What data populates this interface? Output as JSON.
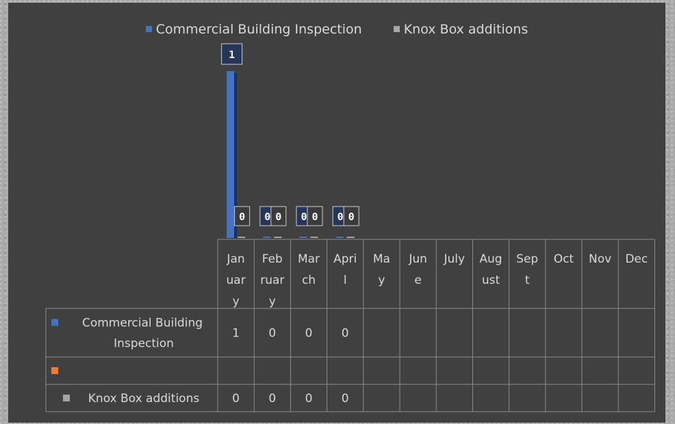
{
  "chart_data": {
    "type": "bar",
    "categories": [
      "Jan\nuar\ny",
      "Feb\nruar\ny",
      "Mar\nch",
      "Apri\nl",
      "Ma\ny",
      "Jun\ne",
      "July",
      "Aug\nust",
      "Sep\nt",
      "Oct",
      "Nov",
      "Dec"
    ],
    "series": [
      {
        "name": "Commercial Building Inspection",
        "color": "#4472c4",
        "values": [
          1,
          0,
          0,
          0,
          null,
          null,
          null,
          null,
          null,
          null,
          null,
          null
        ]
      },
      {
        "name": "",
        "color": "#ed7d31",
        "values": [
          null,
          null,
          null,
          null,
          null,
          null,
          null,
          null,
          null,
          null,
          null,
          null
        ]
      },
      {
        "name": "Knox Box additions",
        "color": "#a5a5a5",
        "values": [
          0,
          0,
          0,
          0,
          null,
          null,
          null,
          null,
          null,
          null,
          null,
          null
        ]
      }
    ],
    "ylim": [
      0,
      1
    ],
    "grid": false,
    "legend": "top",
    "data_table": true
  },
  "legend": {
    "item1": "Commercial Building Inspection",
    "item2": "Knox Box additions"
  }
}
